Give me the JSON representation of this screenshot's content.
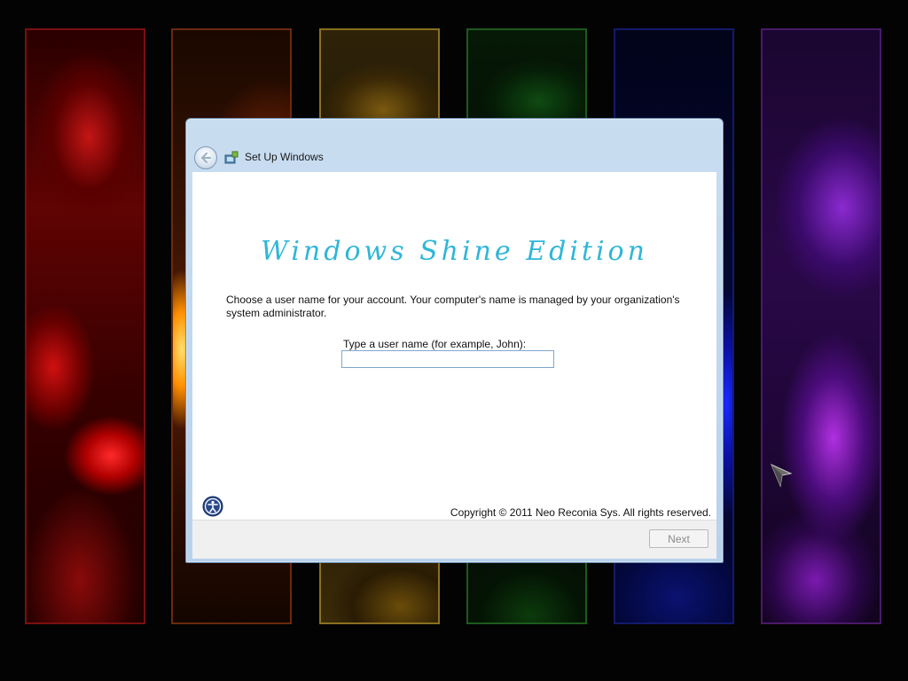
{
  "window": {
    "title": "Set Up Windows"
  },
  "main": {
    "edition_title": "Windows Shine Edition",
    "instructions": "Choose a user name for your account.  Your computer's name is managed by your organization's system administrator.",
    "username_label": "Type a user name (for example, John):",
    "username_value": "",
    "username_placeholder": ""
  },
  "footer": {
    "copyright": "Copyright © 2011 Neo Reconia Sys.  All rights reserved.",
    "next_label": "Next",
    "next_enabled": false
  },
  "icons": {
    "back": "back-arrow-icon",
    "setup": "setup-windows-icon",
    "accessibility": "ease-of-access-icon",
    "cursor": "mouse-pointer-icon"
  },
  "colors": {
    "edition_title": "#2fb6d8",
    "window_frame": "#b8d2ec",
    "panels": [
      "#b00000",
      "#ff9000",
      "#7a5a10",
      "#0f4a12",
      "#1a2aff",
      "#8a2ad0"
    ]
  }
}
